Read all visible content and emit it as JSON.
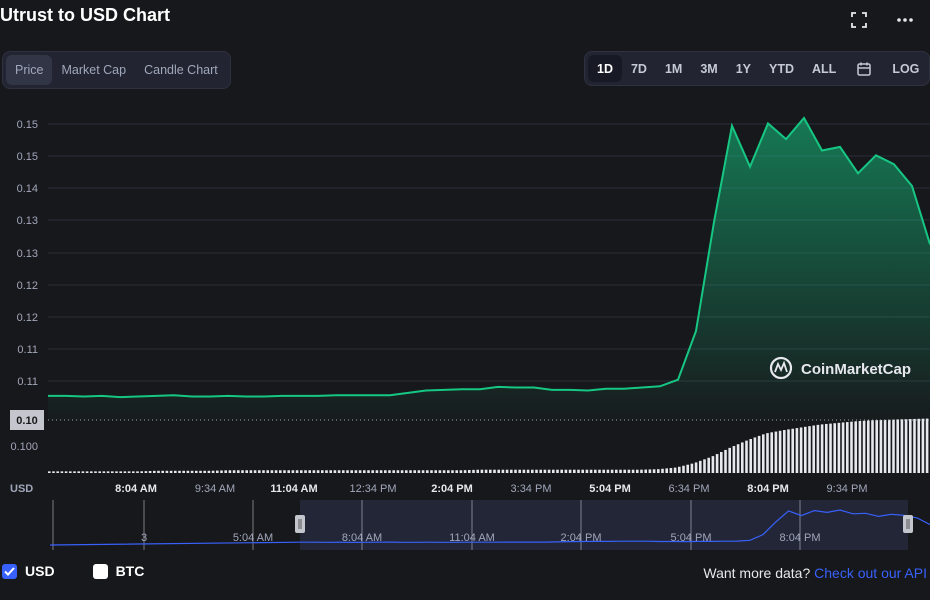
{
  "page": {
    "title": "Utrust to USD Chart"
  },
  "header_icons": [
    "fullscreen-icon",
    "more-options-icon"
  ],
  "chart_type_tabs": {
    "items": [
      "Price",
      "Market Cap",
      "Candle Chart"
    ],
    "active": "Price"
  },
  "range_tabs": {
    "items": [
      "1D",
      "7D",
      "1M",
      "3M",
      "1Y",
      "YTD",
      "ALL"
    ],
    "active": "1D",
    "calendar_icon": "calendar-icon",
    "log_label": "LOG"
  },
  "watermark": "CoinMarketCap",
  "currency_label": "USD",
  "current_price_label": "0.10",
  "legend": {
    "usd_label": "USD",
    "usd_checked": true,
    "btc_label": "BTC",
    "btc_checked": false
  },
  "footer": {
    "prompt": "Want more data? ",
    "link": "Check out our API"
  },
  "colors": {
    "line": "#16c784",
    "accent": "#3861fb",
    "background": "#17181b"
  },
  "chart_data": {
    "type": "area",
    "y_tick_labels": [
      "0.15",
      "0.15",
      "0.14",
      "0.13",
      "0.13",
      "0.12",
      "0.12",
      "0.11",
      "0.11",
      "0.10",
      "0.100"
    ],
    "x_tick_labels": [
      {
        "label": "8:04 AM",
        "bold": true
      },
      {
        "label": "9:34 AM",
        "bold": false
      },
      {
        "label": "11:04 AM",
        "bold": true
      },
      {
        "label": "12:34 PM",
        "bold": false
      },
      {
        "label": "2:04 PM",
        "bold": true
      },
      {
        "label": "3:34 PM",
        "bold": false
      },
      {
        "label": "5:04 PM",
        "bold": true
      },
      {
        "label": "6:34 PM",
        "bold": false
      },
      {
        "label": "8:04 PM",
        "bold": true
      },
      {
        "label": "9:34 PM",
        "bold": false
      }
    ],
    "navigator_labels": [
      "3",
      "5:04 AM",
      "8:04 AM",
      "11:04 AM",
      "2:04 PM",
      "5:04 PM",
      "8:04 PM"
    ],
    "price_values": [
      0.1047,
      0.1047,
      0.1046,
      0.1047,
      0.1045,
      0.1046,
      0.1047,
      0.1048,
      0.1046,
      0.1046,
      0.1047,
      0.1046,
      0.1046,
      0.1047,
      0.1047,
      0.1047,
      0.1048,
      0.1048,
      0.1048,
      0.1048,
      0.1052,
      0.1056,
      0.1057,
      0.1058,
      0.1058,
      0.1062,
      0.1061,
      0.1061,
      0.1057,
      0.1057,
      0.1056,
      0.1059,
      0.1059,
      0.1061,
      0.1063,
      0.1074,
      0.1155,
      0.1336,
      0.1496,
      0.1428,
      0.15,
      0.1474,
      0.1509,
      0.1455,
      0.1461,
      0.1417,
      0.1447,
      0.1432,
      0.1396,
      0.1299
    ],
    "volume_levels": [
      0.03,
      0.03,
      0.03,
      0.03,
      0.03,
      0.03,
      0.04,
      0.04,
      0.04,
      0.04,
      0.05,
      0.05,
      0.05,
      0.05,
      0.05,
      0.05,
      0.05,
      0.05,
      0.05,
      0.05,
      0.05,
      0.05,
      0.05,
      0.05,
      0.06,
      0.06,
      0.06,
      0.06,
      0.06,
      0.06,
      0.06,
      0.06,
      0.06,
      0.06,
      0.07,
      0.1,
      0.18,
      0.3,
      0.46,
      0.6,
      0.72,
      0.78,
      0.83,
      0.88,
      0.91,
      0.94,
      0.96,
      0.97,
      0.98,
      0.99
    ]
  }
}
